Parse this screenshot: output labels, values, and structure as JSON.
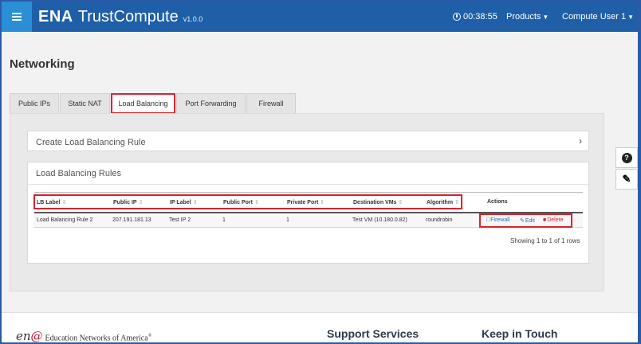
{
  "header": {
    "brand_short": "ENA",
    "brand_name": "TrustCompute",
    "version": "v1.0.0",
    "timer": "00:38:55",
    "products_label": "Products",
    "user_label": "Compute User 1",
    "bar_color": "#1f5fa8",
    "menu_color": "#2a8fd6"
  },
  "page": {
    "title": "Networking"
  },
  "tabs": [
    {
      "label": "Public IPs",
      "active": false
    },
    {
      "label": "Static NAT",
      "active": false
    },
    {
      "label": "Load Balancing",
      "active": true
    },
    {
      "label": "Port Forwarding",
      "active": false
    },
    {
      "label": "Firewall",
      "active": false
    }
  ],
  "create_rule": {
    "label": "Create Load Balancing Rule",
    "icon": "chevron-right-icon"
  },
  "rules": {
    "title": "Load Balancing Rules",
    "columns": [
      "LB Label",
      "Public IP",
      "IP Label",
      "Public Port",
      "Private Port",
      "Destination VMs",
      "Algorithm",
      "Actions"
    ],
    "rows": [
      {
        "lb_label": "Load Balancing Rule 2",
        "public_ip": "207.191.181.13",
        "ip_label": "Test IP 2",
        "public_port": "1",
        "private_port": "1",
        "destination_vms": "Test VM (10.180.0.82)",
        "algorithm": "roundrobin"
      }
    ],
    "actions": {
      "firewall": "Firewall",
      "edit": "Edit",
      "delete": "Delete"
    },
    "showing": "Showing 1 to 1 of 1 rows"
  },
  "highlight_color": "#d9232e",
  "footer": {
    "logo_mark": "en",
    "logo_at": "@",
    "logo_text": "Education Networks of America",
    "logo_tm": "®",
    "support_title": "Support Services",
    "touch_title": "Keep in Touch"
  }
}
